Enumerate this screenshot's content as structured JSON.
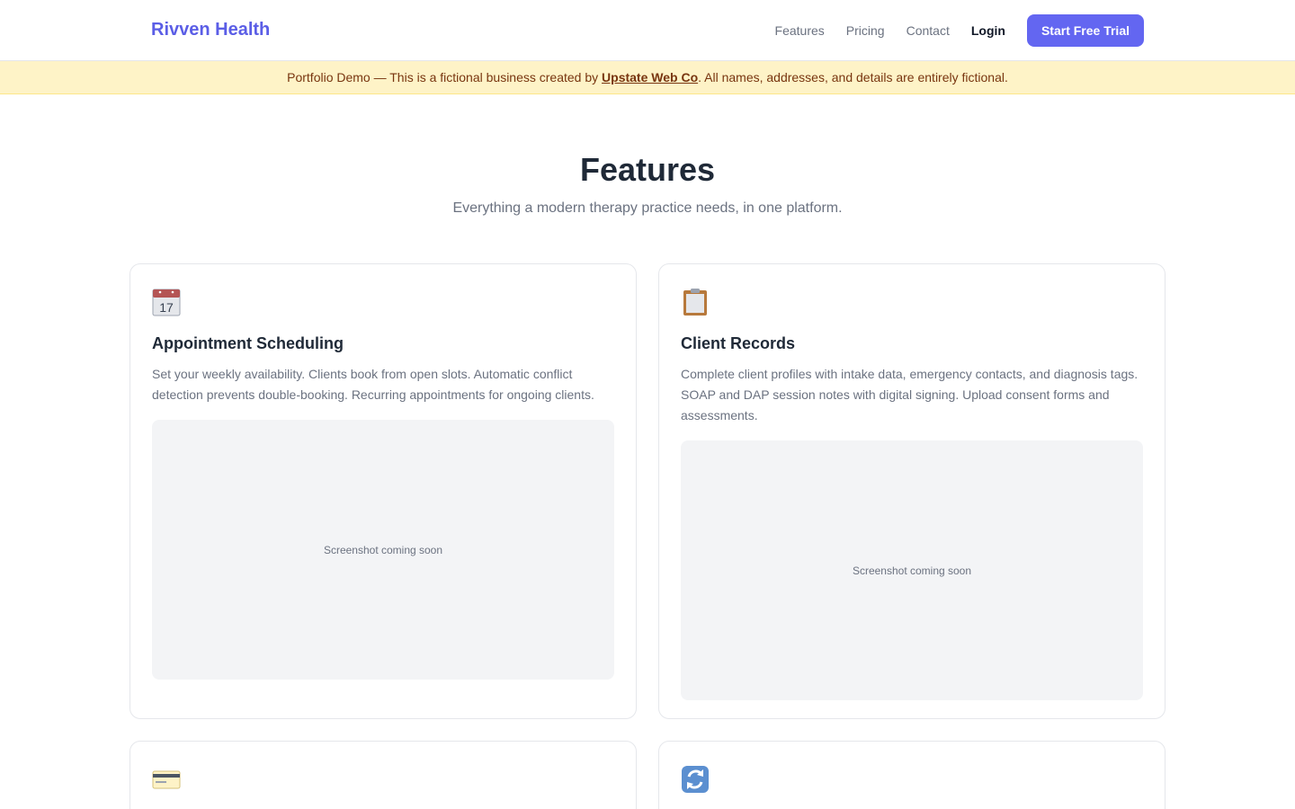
{
  "nav": {
    "brand": "Rivven Health",
    "links": [
      "Features",
      "Pricing",
      "Contact"
    ],
    "login": "Login",
    "cta": "Start Free Trial"
  },
  "banner": {
    "prefix": "Portfolio Demo — This is a fictional business created by ",
    "link": "Upstate Web Co",
    "suffix": ". All names, addresses, and details are entirely fictional."
  },
  "hero": {
    "title": "Features",
    "subtitle": "Everything a modern therapy practice needs, in one platform."
  },
  "features": [
    {
      "icon": "calendar-icon",
      "title": "Appointment Scheduling",
      "description": "Set your weekly availability. Clients book from open slots. Automatic conflict detection prevents double-booking. Recurring appointments for ongoing clients.",
      "placeholder": "Screenshot coming soon"
    },
    {
      "icon": "clipboard-icon",
      "title": "Client Records",
      "description": "Complete client profiles with intake data, emergency contacts, and diagnosis tags. SOAP and DAP session notes with digital signing. Upload consent forms and assessments.",
      "placeholder": "Screenshot coming soon"
    },
    {
      "icon": "credit-card-icon"
    },
    {
      "icon": "refresh-icon"
    }
  ],
  "calendar_day": "17",
  "colors": {
    "brand": "#5b5ee6",
    "accent": "#6366f1",
    "banner_bg": "#fef3c7",
    "banner_text": "#78350f"
  }
}
